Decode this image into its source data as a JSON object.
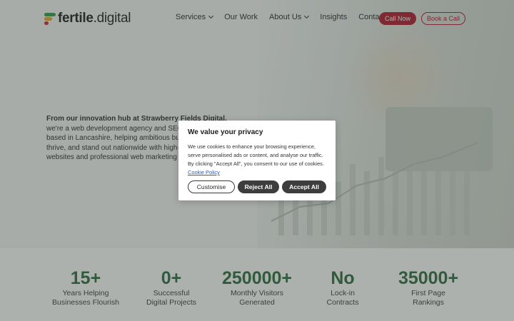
{
  "brand": {
    "name_bold": "fertile",
    "name_light": ".digital",
    "colors": {
      "green": "#2f9a4b",
      "amber": "#e0a52c",
      "red": "#c8262f",
      "accent": "#b0162a",
      "stat_green": "#2b6a3b"
    }
  },
  "nav": {
    "items": [
      {
        "label": "Services",
        "has_dropdown": true
      },
      {
        "label": "Our Work",
        "has_dropdown": false
      },
      {
        "label": "About Us",
        "has_dropdown": true
      },
      {
        "label": "Insights",
        "has_dropdown": false
      },
      {
        "label": "Contact",
        "has_dropdown": false
      }
    ],
    "call_label": "Call Now",
    "book_label": "Book a Call"
  },
  "hero": {
    "lead": "From our innovation hub at Strawberry Fields Digital,",
    "body": "we're a web development agency and SEO company based in Lancashire, helping ambitious businesses grow, thrive, and stand out nationwide with high-performance websites and professional web marketing strategies."
  },
  "stats": [
    {
      "value": "15+",
      "label": "Years Helping Businesses Flourish"
    },
    {
      "value": "0+",
      "label": "Successful Digital Projects"
    },
    {
      "value": "250000+",
      "label": "Monthly Visitors Generated"
    },
    {
      "value": "No",
      "label": "Lock-in Contracts"
    },
    {
      "value": "35000+",
      "label": "First Page Rankings"
    }
  ],
  "cookie": {
    "title": "We value your privacy",
    "text": "We use cookies to enhance your browsing experience, serve personalised ads or content, and analyse our traffic. By clicking \"Accept All\", you consent to our use of cookies.",
    "policy_link": "Cookie Policy",
    "customise_label": "Customise",
    "reject_label": "Reject All",
    "accept_label": "Accept All"
  }
}
